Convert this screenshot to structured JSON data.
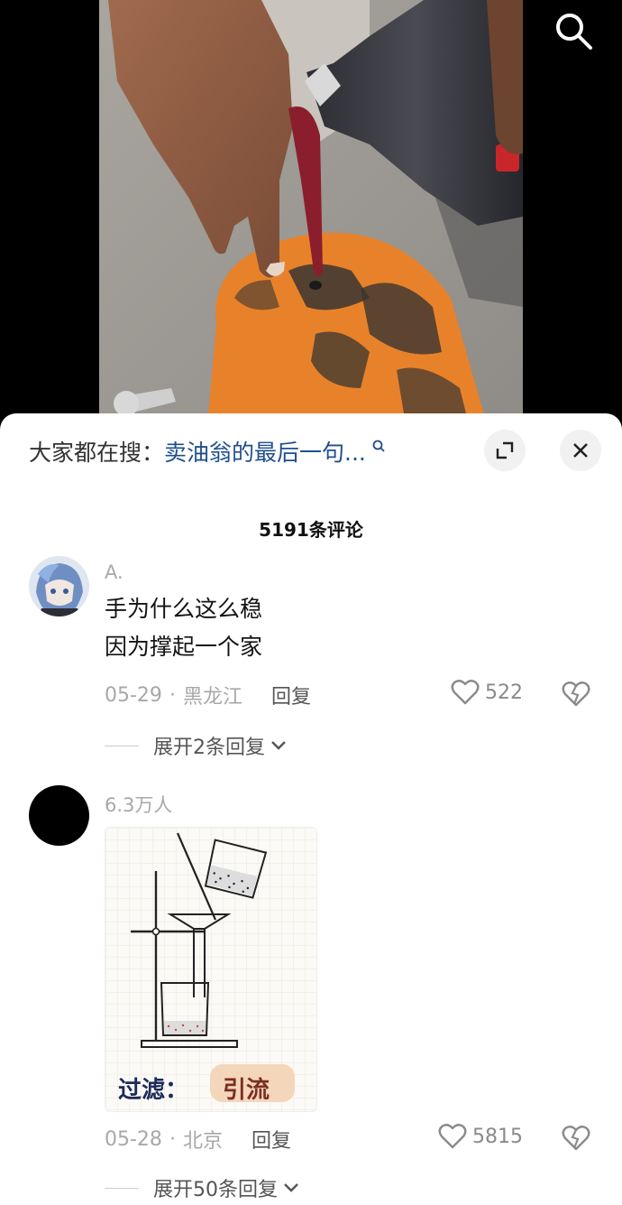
{
  "search_bar": {
    "prefix": "大家都在搜：",
    "query": "卖油翁的最后一句..."
  },
  "comments_title": "5191条评论",
  "comments": [
    {
      "username": "A.",
      "text_lines": [
        "手为什么这么稳",
        "因为撑起一个家"
      ],
      "date": "05-29",
      "separator": "·",
      "location": "黑龙江",
      "reply_label": "回复",
      "likes": "522",
      "expand_label": "展开2条回复"
    },
    {
      "username": "6.3万人",
      "image_caption": {
        "left": "过滤：",
        "right": "引流"
      },
      "date": "05-28",
      "separator": "·",
      "location": "北京",
      "reply_label": "回复",
      "likes": "5815",
      "expand_label": "展开50条回复"
    }
  ],
  "icons": {
    "top_search": "search-icon",
    "expand": "expand-icon",
    "close": "close-icon",
    "like": "heart-icon",
    "dislike": "broken-heart-icon",
    "chevron": "chevron-down-icon"
  },
  "colors": {
    "query_link": "#1f4f8c",
    "meta_gray": "#a8a8a8",
    "cylinder_orange": "#e8822a"
  }
}
